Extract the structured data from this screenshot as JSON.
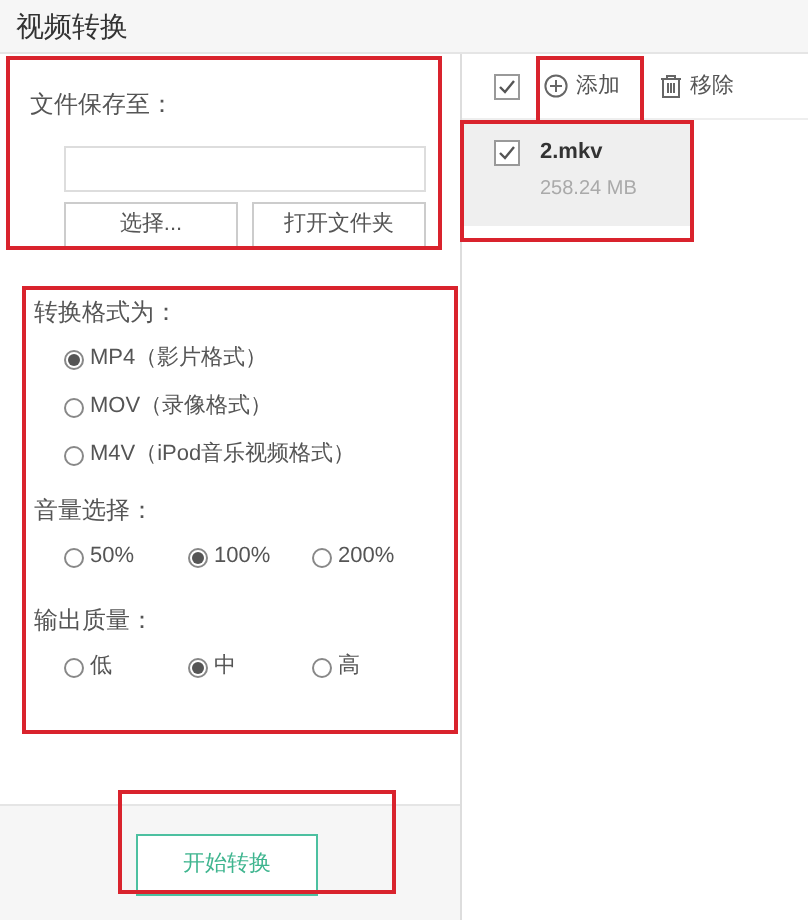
{
  "window": {
    "title": "视频转换"
  },
  "save": {
    "label": "文件保存至：",
    "buttons": [
      "选择...",
      "打开文件夹"
    ],
    "highlighted": true
  },
  "options": {
    "highlighted": true,
    "groups": [
      {
        "label": "转换格式为：",
        "kind": "stacked",
        "items": [
          {
            "label": "MP4（影片格式）",
            "selected": true
          },
          {
            "label": "MOV（录像格式）",
            "selected": false
          },
          {
            "label": "M4V（iPod音乐视频格式）",
            "selected": false
          }
        ]
      },
      {
        "label": "音量选择：",
        "kind": "inline",
        "items": [
          {
            "label": "50%",
            "selected": false
          },
          {
            "label": "100%",
            "selected": true
          },
          {
            "label": "200%",
            "selected": false
          }
        ]
      },
      {
        "label": "输出质量：",
        "kind": "inline",
        "items": [
          {
            "label": "低",
            "selected": false
          },
          {
            "label": "中",
            "selected": true
          },
          {
            "label": "高",
            "selected": false
          }
        ]
      }
    ]
  },
  "start_button": {
    "label": "开始转换",
    "highlighted": true
  },
  "toolbar": {
    "select_all": {
      "checked": true
    },
    "add": {
      "label": "添加",
      "highlighted": true
    },
    "remove": {
      "label": "移除"
    }
  },
  "files": [
    {
      "name": "2.mkv",
      "size": "258.24 MB",
      "checked": true,
      "highlighted": true
    }
  ]
}
